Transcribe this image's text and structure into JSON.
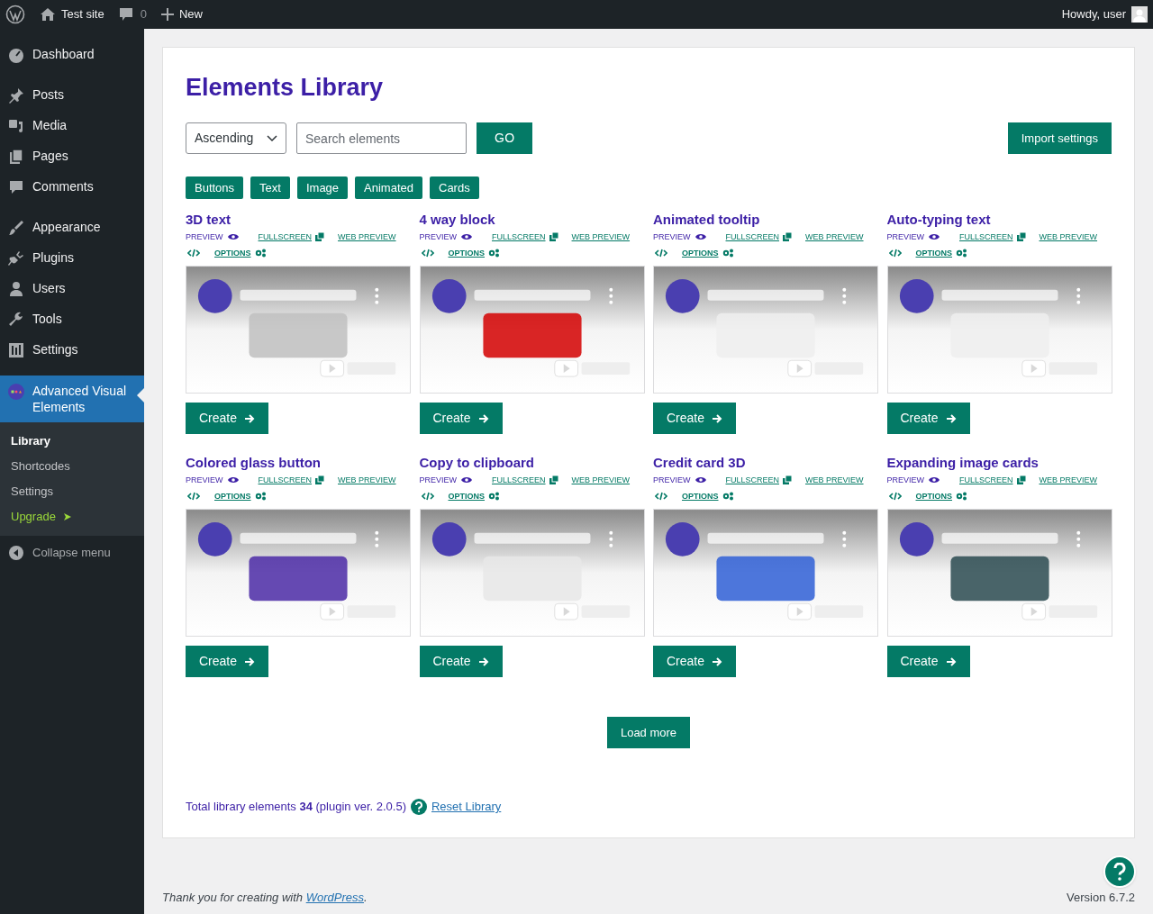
{
  "admin_bar": {
    "site": "Test site",
    "comments": "0",
    "new": "New",
    "greeting": "Howdy, user"
  },
  "sidebar": {
    "items": [
      {
        "label": "Dashboard",
        "selected": false
      },
      {
        "label": "Posts",
        "selected": false
      },
      {
        "label": "Media",
        "selected": false
      },
      {
        "label": "Pages",
        "selected": false
      },
      {
        "label": "Comments",
        "selected": false
      },
      {
        "label": "Appearance",
        "selected": false
      },
      {
        "label": "Plugins",
        "selected": false
      },
      {
        "label": "Users",
        "selected": false
      },
      {
        "label": "Tools",
        "selected": false
      },
      {
        "label": "Settings",
        "selected": false
      },
      {
        "label": "Advanced Visual Elements",
        "selected": true
      }
    ],
    "submenu": [
      {
        "label": "Library",
        "kind": "current"
      },
      {
        "label": "Shortcodes",
        "kind": "plain"
      },
      {
        "label": "Settings",
        "kind": "plain"
      },
      {
        "label": "Upgrade",
        "kind": "upgrade"
      }
    ],
    "collapse": "Collapse menu"
  },
  "title": "Elements Library",
  "sort": {
    "value": "Ascending"
  },
  "search": {
    "placeholder": "Search elements"
  },
  "go": "GO",
  "import": "Import settings",
  "filters": [
    "Buttons",
    "Text",
    "Image",
    "Animated",
    "Cards"
  ],
  "elements": [
    {
      "name": "3D text",
      "preview": "PREVIEW",
      "fullscreen": "FULLSCREEN",
      "web_preview": "WEB PREVIEW",
      "options": "OPTIONS",
      "create": "Create"
    },
    {
      "name": "4 way block",
      "preview": "PREVIEW",
      "fullscreen": "FULLSCREEN",
      "web_preview": "WEB PREVIEW",
      "options": "OPTIONS",
      "create": "Create"
    },
    {
      "name": "Animated tooltip",
      "preview": "PREVIEW",
      "fullscreen": "FULLSCREEN",
      "web_preview": "WEB PREVIEW",
      "options": "OPTIONS",
      "create": "Create"
    },
    {
      "name": "Auto-typing text",
      "preview": "PREVIEW",
      "fullscreen": "FULLSCREEN",
      "web_preview": "WEB PREVIEW",
      "options": "OPTIONS",
      "create": "Create"
    },
    {
      "name": "Colored glass button",
      "preview": "PREVIEW",
      "fullscreen": "FULLSCREEN",
      "web_preview": "WEB PREVIEW",
      "options": "OPTIONS",
      "create": "Create"
    },
    {
      "name": "Copy to clipboard",
      "preview": "PREVIEW",
      "fullscreen": "FULLSCREEN",
      "web_preview": "WEB PREVIEW",
      "options": "OPTIONS",
      "create": "Create"
    },
    {
      "name": "Credit card 3D",
      "preview": "PREVIEW",
      "fullscreen": "FULLSCREEN",
      "web_preview": "WEB PREVIEW",
      "options": "OPTIONS",
      "create": "Create"
    },
    {
      "name": "Expanding image cards",
      "preview": "PREVIEW",
      "fullscreen": "FULLSCREEN",
      "web_preview": "WEB PREVIEW",
      "options": "OPTIONS",
      "create": "Create"
    }
  ],
  "load_more": "Load more",
  "summary": "Total library elements **34** (plugin ver. 2.0.5)",
  "reset": "Reset Library",
  "footer": {
    "thanks": "Thank you for creating with",
    "link": "WordPress",
    "end": ".",
    "version": "Version 6.7.2"
  }
}
